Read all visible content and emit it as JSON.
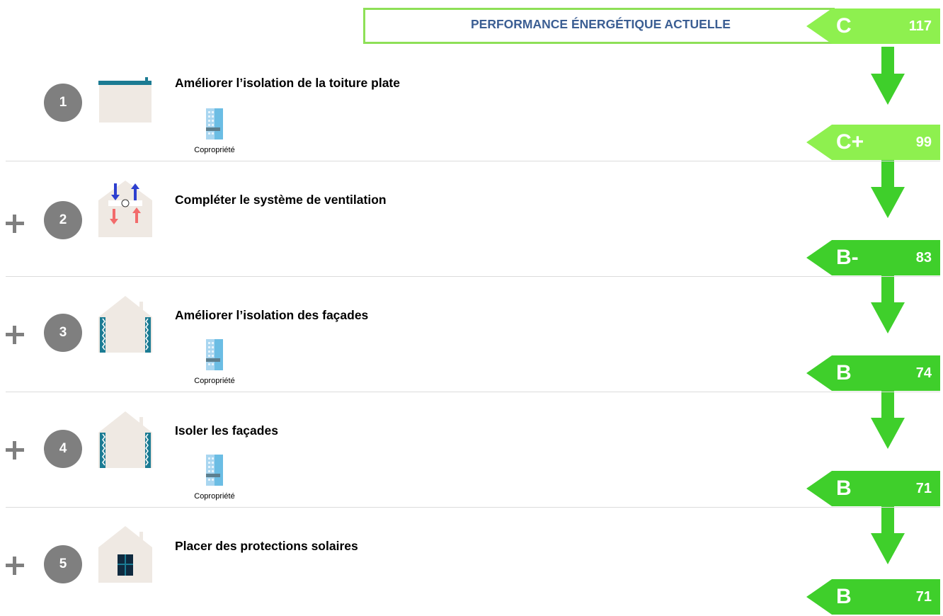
{
  "header": {
    "label": "PERFORMANCE ÉNERGÉTIQUE ACTUELLE"
  },
  "current": {
    "class": "C",
    "value": "117"
  },
  "measures": [
    {
      "number": "1",
      "title": "Améliorer l’isolation de la toiture plate",
      "tag": "Copropriété",
      "icon": "flat-roof-icon"
    },
    {
      "number": "2",
      "title": "Compléter le système de ventilation",
      "tag": "",
      "icon": "ventilation-icon"
    },
    {
      "number": "3",
      "title": "Améliorer l’isolation des façades",
      "tag": "Copropriété",
      "icon": "facade-insulation-icon"
    },
    {
      "number": "4",
      "title": "Isoler les façades",
      "tag": "Copropriété",
      "icon": "facade-insulation-icon"
    },
    {
      "number": "5",
      "title": "Placer des protections solaires",
      "tag": "",
      "icon": "window-shading-icon"
    }
  ],
  "results": [
    {
      "class": "C+",
      "value": "99"
    },
    {
      "class": "B-",
      "value": "83"
    },
    {
      "class": "B",
      "value": "74"
    },
    {
      "class": "B",
      "value": "71"
    },
    {
      "class": "B",
      "value": "71"
    }
  ],
  "colors": {
    "current_badge": "#8ef04f",
    "result_badge": "#3fcf2b",
    "arrow": "#3fcf2b",
    "circle": "#7f7f7f",
    "header_text": "#3b5e93",
    "header_border": "#8ee057"
  }
}
